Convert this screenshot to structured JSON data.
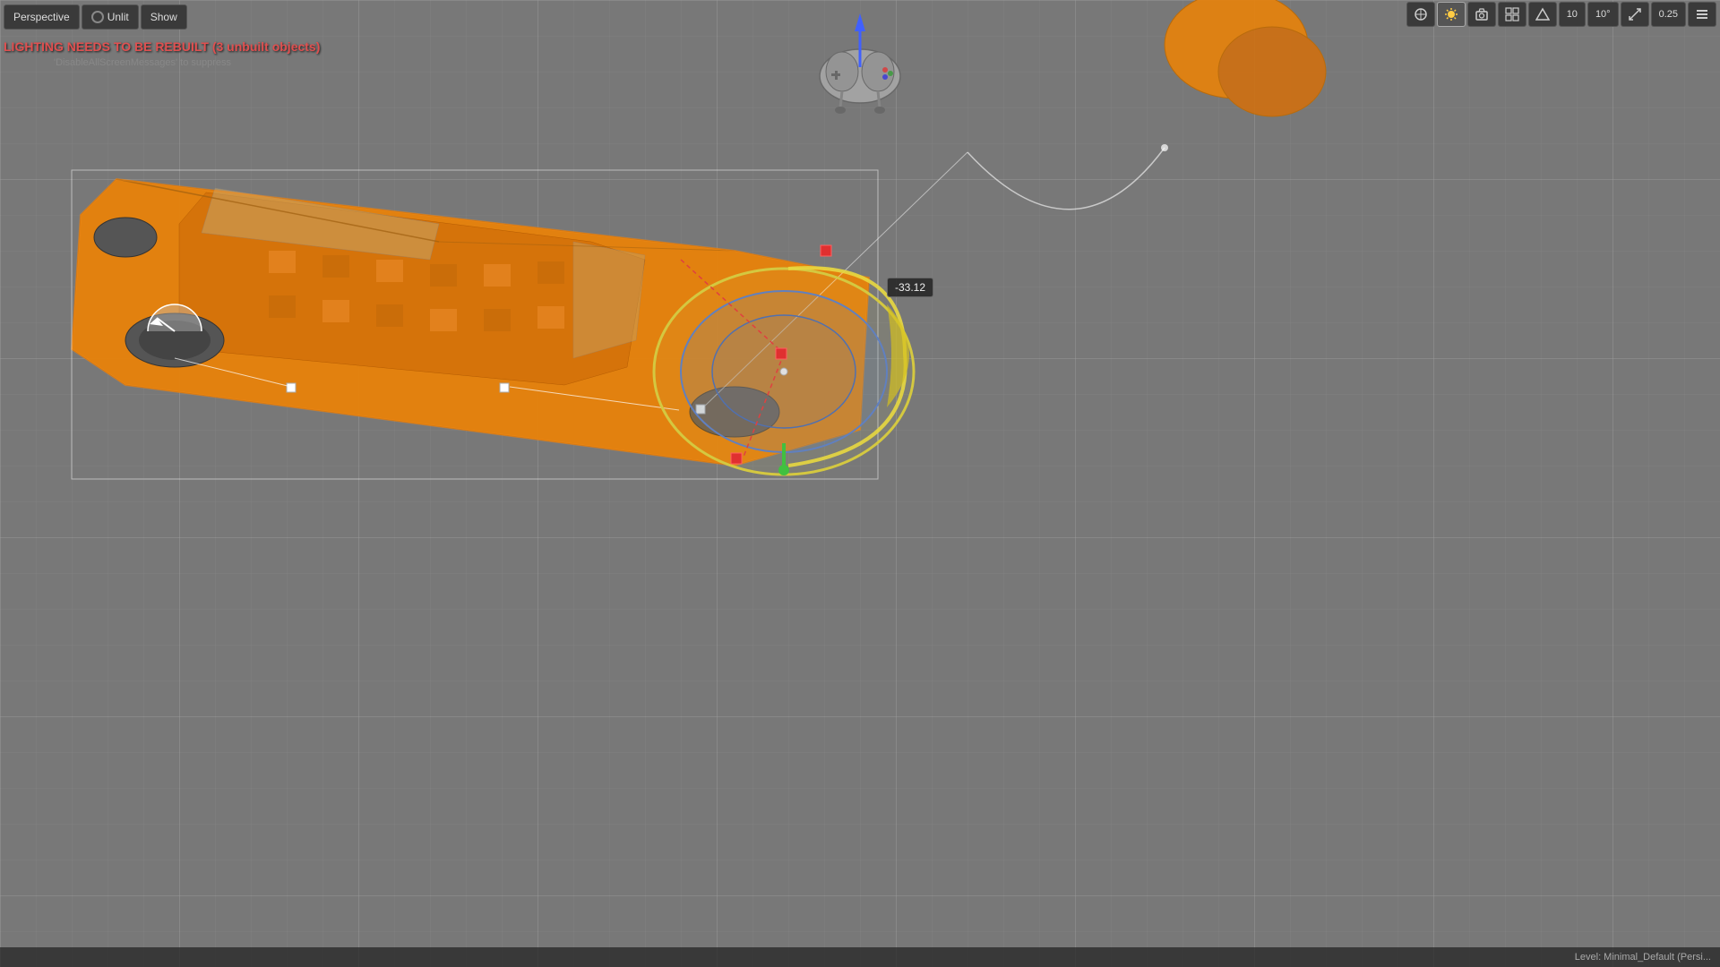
{
  "toolbar": {
    "perspective_label": "Perspective",
    "unlit_label": "Unlit",
    "show_label": "Show"
  },
  "right_toolbar": {
    "transform_label": "⊕",
    "sun_label": "☀",
    "camera_label": "📷",
    "grid_label": "⊞",
    "snap_value": "10",
    "angle_value": "10°",
    "scale_icon": "⤡",
    "scale_value": "0.25",
    "menu_icon": "≡"
  },
  "warning": {
    "main": "LIGHTING NEEDS TO BE REBUILT (3 unbuilt objects)",
    "sub": "'DisableAllScreenMessages' to suppress"
  },
  "tooltip": {
    "value": "-33.12"
  },
  "status": {
    "level": "Level: Minimal_Default (Persi..."
  }
}
